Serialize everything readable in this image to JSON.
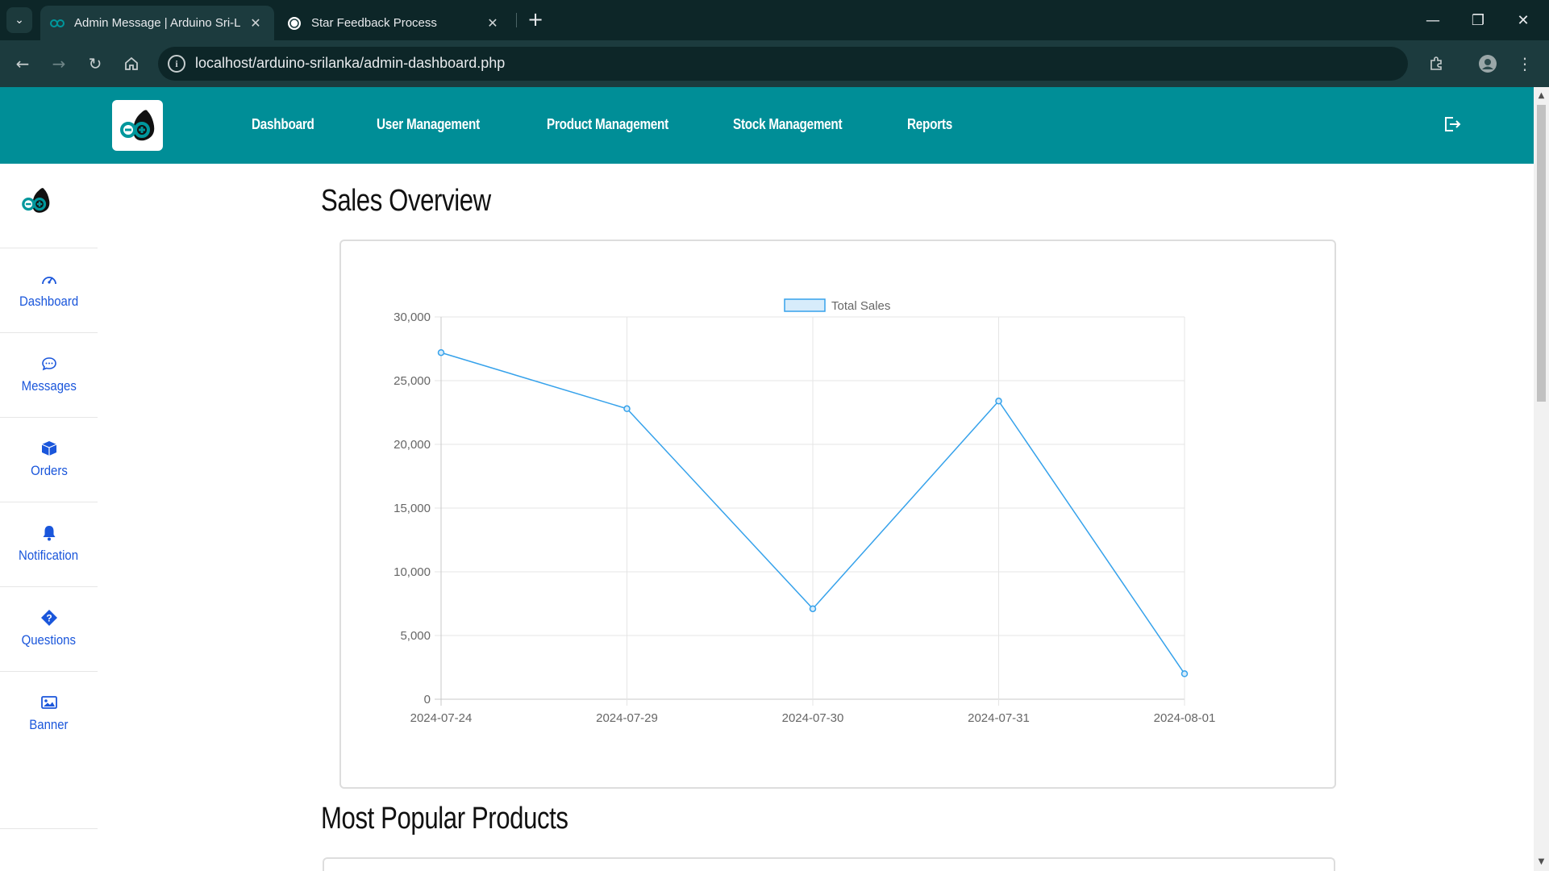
{
  "browser": {
    "tabs": [
      {
        "title": "Admin Message | Arduino Sri-L",
        "active": true
      },
      {
        "title": "Star Feedback Process",
        "active": false
      }
    ],
    "url": "localhost/arduino-srilanka/admin-dashboard.php"
  },
  "topnav": {
    "links": [
      "Dashboard",
      "User Management",
      "Product Management",
      "Stock Management",
      "Reports"
    ]
  },
  "sidebar": {
    "items": [
      {
        "label": "Dashboard",
        "icon": "gauge-icon"
      },
      {
        "label": "Messages",
        "icon": "chat-icon"
      },
      {
        "label": "Orders",
        "icon": "box-icon"
      },
      {
        "label": "Notification",
        "icon": "bell-icon"
      },
      {
        "label": "Questions",
        "icon": "question-icon"
      },
      {
        "label": "Banner",
        "icon": "image-icon"
      }
    ]
  },
  "sections": {
    "sales_title": "Sales Overview",
    "popular_title": "Most Popular Products"
  },
  "colors": {
    "brand": "#008e97",
    "accent": "#1a56db",
    "series": "#36a2eb"
  },
  "chart_data": {
    "type": "line",
    "categories": [
      "2024-07-24",
      "2024-07-29",
      "2024-07-30",
      "2024-07-31",
      "2024-08-01"
    ],
    "series": [
      {
        "name": "Total Sales",
        "values": [
          27200,
          22800,
          7100,
          23400,
          2000
        ]
      }
    ],
    "ylim": [
      0,
      30000
    ],
    "yticks": [
      "0",
      "5,000",
      "10,000",
      "15,000",
      "20,000",
      "25,000",
      "30,000"
    ],
    "grid": true,
    "legend": "top-center"
  }
}
